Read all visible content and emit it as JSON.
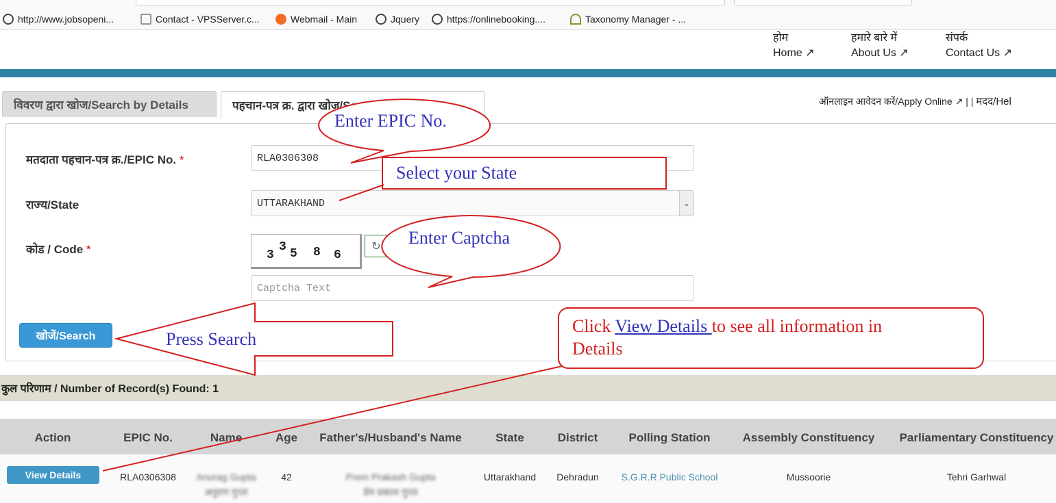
{
  "browser": {
    "bookmarks": [
      {
        "label": "http://www.jobsopeni...",
        "icon": "globe-icon"
      },
      {
        "label": "Contact - VPSServer.c...",
        "icon": "vpsserver-icon"
      },
      {
        "label": "Webmail - Main",
        "icon": "cpanel-icon"
      },
      {
        "label": "Jquery",
        "icon": "globe-icon"
      },
      {
        "label": "https://onlinebooking....",
        "icon": "globe-icon"
      },
      {
        "label": "Taxonomy Manager - ...",
        "icon": "tree-icon"
      }
    ]
  },
  "nav": [
    {
      "hindi": "होम",
      "english": "Home"
    },
    {
      "hindi": "हमारे बारे में",
      "english": "About Us"
    },
    {
      "hindi": "संपर्क",
      "english": "Contact Us"
    }
  ],
  "tabs": [
    {
      "label": "विवरण द्वारा खोज/Search by Details",
      "active": false
    },
    {
      "label": "पहचान-पत्र क्र. द्वारा खोज/Search by EPIC No.",
      "active": true
    }
  ],
  "top_links": {
    "apply": "ऑनलाइन आवेदन करें/Apply Online",
    "sep": "| |",
    "help": "मदद/Hel"
  },
  "form": {
    "epic_label": "मतदाता पहचान-पत्र क्र./EPIC No.",
    "epic_value": "RLA0306308",
    "state_label": "राज्य/State",
    "state_value": "UTTARAKHAND",
    "code_label": "कोड / Code",
    "required": "*",
    "captcha": [
      "3",
      "3",
      "5",
      "8",
      "6"
    ],
    "captcha_placeholder": "Captcha Text",
    "search_label": "खोजें/Search"
  },
  "records": "कुल परिणाम / Number of Record(s) Found: 1",
  "table": {
    "headers": [
      "Action",
      "EPIC No.",
      "Name",
      "Age",
      "Father's/Husband's Name",
      "State",
      "District",
      "Polling Station",
      "Assembly Constituency",
      "Parliamentary Constituency"
    ],
    "rows": [
      {
        "action": "View Details",
        "epic": "RLA0306308",
        "name": "Anurag Gupta",
        "name_hi": "अनुराग गुप्ता",
        "age": "42",
        "father": "Prem Prakash Gupta",
        "father_hi": "प्रेम प्रकाश गुप्ता",
        "state": "Uttarakhand",
        "district": "Dehradun",
        "polling": "S.G.R.R Public School",
        "assembly": "Mussoorie",
        "parliamentary": "Tehri Garhwal"
      }
    ]
  },
  "annotations": {
    "epic": "Enter EPIC No.",
    "state": "Select your State",
    "captcha": "Enter Captcha",
    "search": "Press Search",
    "details_pre": "Click ",
    "details_link": "View Details ",
    "details_post": "to see all information in",
    "details_line2": "Details"
  },
  "colors": {
    "band": "#2f84a6",
    "search_button": "#3a98d6",
    "annotation_red": "#d42020",
    "annotation_text": "#3333bb",
    "link": "#4a8fb0"
  }
}
